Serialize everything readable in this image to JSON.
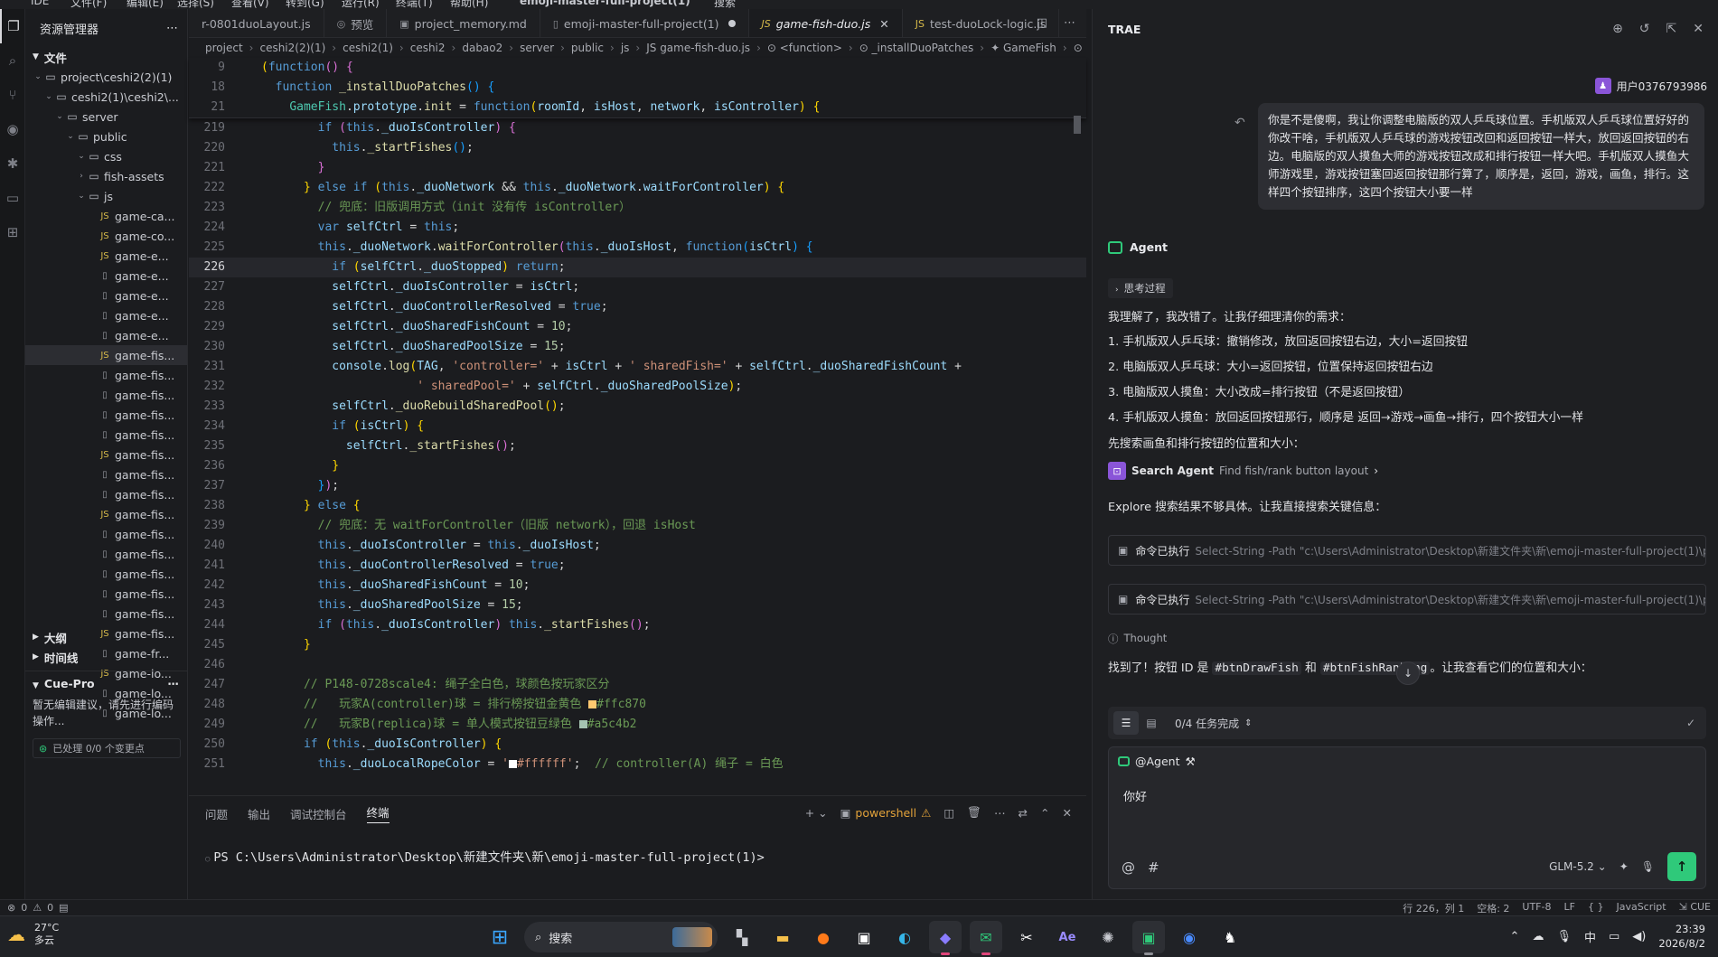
{
  "titlebar": {
    "ide": "IDE",
    "file": "文件(F)",
    "edit": "编辑(E)",
    "select": "选择(S)",
    "view": "查看(V)",
    "goto": "转到(G)",
    "run": "运行(R)",
    "terminal": "终端(T)",
    "help": "帮助(H)",
    "project": "emoji-master-full-project(1)",
    "search": "搜索"
  },
  "sidebar": {
    "title": "资源管理器",
    "section_files": "文件",
    "tree": [
      {
        "label": "project\\ceshi2(2)(1)",
        "type": "folder",
        "indent": 0,
        "open": true
      },
      {
        "label": "ceshi2(1)\\ceshi2\\...",
        "type": "folder",
        "indent": 1,
        "open": true
      },
      {
        "label": "server",
        "type": "folder",
        "indent": 2,
        "open": true
      },
      {
        "label": "public",
        "type": "folder",
        "indent": 3,
        "open": true
      },
      {
        "label": "css",
        "type": "folder",
        "indent": 4,
        "open": true
      },
      {
        "label": "fish-assets",
        "type": "folder",
        "indent": 4,
        "open": false
      },
      {
        "label": "js",
        "type": "folder",
        "indent": 4,
        "open": true
      },
      {
        "label": "game-ca...",
        "type": "js",
        "indent": 5
      },
      {
        "label": "game-co...",
        "type": "js",
        "indent": 5
      },
      {
        "label": "game-e...",
        "type": "js",
        "indent": 5
      },
      {
        "label": "game-e...",
        "type": "file",
        "indent": 5
      },
      {
        "label": "game-e...",
        "type": "file",
        "indent": 5
      },
      {
        "label": "game-e...",
        "type": "file",
        "indent": 5
      },
      {
        "label": "game-e...",
        "type": "file",
        "indent": 5
      },
      {
        "label": "game-fis...",
        "type": "js",
        "indent": 5,
        "selected": true
      },
      {
        "label": "game-fis...",
        "type": "file",
        "indent": 5
      },
      {
        "label": "game-fis...",
        "type": "file",
        "indent": 5
      },
      {
        "label": "game-fis...",
        "type": "file",
        "indent": 5
      },
      {
        "label": "game-fis...",
        "type": "file",
        "indent": 5
      },
      {
        "label": "game-fis...",
        "type": "js",
        "indent": 5
      },
      {
        "label": "game-fis...",
        "type": "file",
        "indent": 5
      },
      {
        "label": "game-fis...",
        "type": "file",
        "indent": 5
      },
      {
        "label": "game-fis...",
        "type": "js",
        "indent": 5
      },
      {
        "label": "game-fis...",
        "type": "file",
        "indent": 5
      },
      {
        "label": "game-fis...",
        "type": "file",
        "indent": 5
      },
      {
        "label": "game-fis...",
        "type": "file",
        "indent": 5
      },
      {
        "label": "game-fis...",
        "type": "file",
        "indent": 5
      },
      {
        "label": "game-fis...",
        "type": "file",
        "indent": 5
      },
      {
        "label": "game-fis...",
        "type": "js",
        "indent": 5
      },
      {
        "label": "game-fr...",
        "type": "file",
        "indent": 5
      },
      {
        "label": "game-lo...",
        "type": "js",
        "indent": 5
      },
      {
        "label": "game-lo...",
        "type": "file",
        "indent": 5
      },
      {
        "label": "game-lo...",
        "type": "file",
        "indent": 5
      }
    ],
    "outline": "大纲",
    "timeline": "时间线",
    "cue_title": "Cue-Pro",
    "cue_text": "暂无编辑建议，请先进行编码操作...",
    "cue_status": "已处理 0/0 个变更点"
  },
  "tabs": [
    {
      "label": "r-0801duoLayout.js",
      "icon": "",
      "active": false
    },
    {
      "label": "预览",
      "icon": "◎",
      "active": false
    },
    {
      "label": "project_memory.md",
      "icon": "▣",
      "active": false
    },
    {
      "label": "emoji-master-full-project(1)",
      "icon": "▯",
      "active": false,
      "dirty": true
    },
    {
      "label": "game-fish-duo.js",
      "icon": "JS",
      "active": true
    },
    {
      "label": "test-duoLock-logic.js",
      "icon": "JS",
      "active": false
    }
  ],
  "breadcrumb": [
    "project",
    "ceshi2(2)(1)",
    "ceshi2(1)",
    "ceshi2",
    "dabao2",
    "server",
    "public",
    "js",
    "JS game-fish-duo.js",
    "⊙ <function>",
    "⊙ _installDuoPatches",
    "✦ GameFish",
    "⊙ init",
    "⊙"
  ],
  "code": [
    {
      "ln": "9",
      "sticky": true,
      "html": "<span class='br1'>(</span><span class='kw'>function</span><span class='br2'>()</span> <span class='br2'>{</span>"
    },
    {
      "ln": "18",
      "sticky": true,
      "html": "  <span class='kw'>function</span> <span class='fn'>_installDuoPatches</span><span class='br3'>()</span> <span class='br3'>{</span>"
    },
    {
      "ln": "21",
      "sticky": true,
      "html": "    <span class='cls'>GameFish</span>.<span class='pr'>prototype</span>.<span class='fn'>init</span> = <span class='kw'>function</span><span class='br1'>(</span><span class='pm'>roomId</span>, <span class='pm'>isHost</span>, <span class='pm'>network</span>, <span class='pm'>isController</span><span class='br1'>)</span> <span class='br1'>{</span>"
    },
    {
      "ln": "219",
      "html": "        <span class='kw'>if</span> <span class='br2'>(</span><span class='th'>this</span>.<span class='pr'>_duoIsController</span><span class='br2'>)</span> <span class='br2'>{</span>"
    },
    {
      "ln": "220",
      "html": "          <span class='th'>this</span>.<span class='fn'>_startFishes</span><span class='br3'>()</span>;"
    },
    {
      "ln": "221",
      "html": "        <span class='br2'>}</span>"
    },
    {
      "ln": "222",
      "html": "      <span class='br1'>}</span> <span class='kw'>else if</span> <span class='br1'>(</span><span class='th'>this</span>.<span class='pr'>_duoNetwork</span> &amp;&amp; <span class='th'>this</span>.<span class='pr'>_duoNetwork</span>.<span class='pr'>waitForController</span><span class='br1'>)</span> <span class='br1'>{</span>"
    },
    {
      "ln": "223",
      "html": "        <span class='cm'>// 兜底：旧版调用方式（init 没有传 isController）</span>"
    },
    {
      "ln": "224",
      "html": "        <span class='kw'>var</span> <span class='pm'>selfCtrl</span> = <span class='th'>this</span>;"
    },
    {
      "ln": "225",
      "html": "        <span class='th'>this</span>.<span class='pr'>_duoNetwork</span>.<span class='fn'>waitForController</span><span class='br2'>(</span><span class='th'>this</span>.<span class='pr'>_duoIsHost</span>, <span class='kw'>function</span><span class='br3'>(</span><span class='pm'>isCtrl</span><span class='br3'>)</span> <span class='br3'>{</span>"
    },
    {
      "ln": "226",
      "cur": true,
      "html": "          <span class='kw'>if</span> <span class='br1'>(</span><span class='pm'>selfCtrl</span>.<span class='pr'>_duoStopped</span><span class='br1'>)</span> <span class='kw'>return</span>;"
    },
    {
      "ln": "227",
      "html": "          <span class='pm'>selfCtrl</span>.<span class='pr'>_duoIsController</span> = <span class='pm'>isCtrl</span>;"
    },
    {
      "ln": "228",
      "html": "          <span class='pm'>selfCtrl</span>.<span class='pr'>_duoControllerResolved</span> = <span class='bo'>true</span>;"
    },
    {
      "ln": "229",
      "html": "          <span class='pm'>selfCtrl</span>.<span class='pr'>_duoSharedFishCount</span> = <span class='nm'>10</span>;"
    },
    {
      "ln": "230",
      "html": "          <span class='pm'>selfCtrl</span>.<span class='pr'>_duoSharedPoolSize</span> = <span class='nm'>15</span>;"
    },
    {
      "ln": "231",
      "html": "          <span class='pr'>console</span>.<span class='fn'>log</span><span class='br1'>(</span><span class='pr'>TAG</span>, <span class='st'>'controller='</span> + <span class='pm'>isCtrl</span> + <span class='st'>' sharedFish='</span> + <span class='pm'>selfCtrl</span>.<span class='pr'>_duoSharedFishCount</span> +"
    },
    {
      "ln": "232",
      "html": "                      <span class='st'>' sharedPool='</span> + <span class='pm'>selfCtrl</span>.<span class='pr'>_duoSharedPoolSize</span><span class='br1'>)</span>;"
    },
    {
      "ln": "233",
      "html": "          <span class='pm'>selfCtrl</span>.<span class='fn'>_duoRebuildSharedPool</span><span class='br1'>()</span>;"
    },
    {
      "ln": "234",
      "html": "          <span class='kw'>if</span> <span class='br1'>(</span><span class='pm'>isCtrl</span><span class='br1'>)</span> <span class='br1'>{</span>"
    },
    {
      "ln": "235",
      "html": "            <span class='pm'>selfCtrl</span>.<span class='fn'>_startFishes</span><span class='br2'>()</span>;"
    },
    {
      "ln": "236",
      "html": "          <span class='br1'>}</span>"
    },
    {
      "ln": "237",
      "html": "        <span class='br3'>}</span><span class='br2'>)</span>;"
    },
    {
      "ln": "238",
      "html": "      <span class='br1'>}</span> <span class='kw'>else</span> <span class='br1'>{</span>"
    },
    {
      "ln": "239",
      "html": "        <span class='cm'>// 兜底：无 waitForController（旧版 network），回退 isHost</span>"
    },
    {
      "ln": "240",
      "html": "        <span class='th'>this</span>.<span class='pr'>_duoIsController</span> = <span class='th'>this</span>.<span class='pr'>_duoIsHost</span>;"
    },
    {
      "ln": "241",
      "html": "        <span class='th'>this</span>.<span class='pr'>_duoControllerResolved</span> = <span class='bo'>true</span>;"
    },
    {
      "ln": "242",
      "html": "        <span class='th'>this</span>.<span class='pr'>_duoSharedFishCount</span> = <span class='nm'>10</span>;"
    },
    {
      "ln": "243",
      "html": "        <span class='th'>this</span>.<span class='pr'>_duoSharedPoolSize</span> = <span class='nm'>15</span>;"
    },
    {
      "ln": "244",
      "html": "        <span class='kw'>if</span> <span class='br2'>(</span><span class='th'>this</span>.<span class='pr'>_duoIsController</span><span class='br2'>)</span> <span class='th'>this</span>.<span class='fn'>_startFishes</span><span class='br2'>()</span>;"
    },
    {
      "ln": "245",
      "html": "      <span class='br1'>}</span>"
    },
    {
      "ln": "246",
      "html": ""
    },
    {
      "ln": "247",
      "html": "      <span class='cm'>// P148-0728scale4: 绳子全白色，球颜色按玩家区分</span>"
    },
    {
      "ln": "248",
      "html": "      <span class='cm'>//   玩家A(controller)球 = 排行榜按钮金黄色 </span><span style='display:inline-block;width:9px;height:9px;background:#ffc870;vertical-align:middle'></span><span class='cm'>#ffc870</span>"
    },
    {
      "ln": "249",
      "html": "      <span class='cm'>//   玩家B(replica)球 = 单人模式按钮豆绿色 </span><span style='display:inline-block;width:9px;height:9px;background:#a5c4b2;vertical-align:middle'></span><span class='cm'>#a5c4b2</span>"
    },
    {
      "ln": "250",
      "html": "      <span class='kw'>if</span> <span class='br1'>(</span><span class='th'>this</span>.<span class='pr'>_duoIsController</span><span class='br1'>)</span> <span class='br1'>{</span>"
    },
    {
      "ln": "251",
      "html": "        <span class='th'>this</span>.<span class='pr'>_duoLocalRopeColor</span> = <span class='st'>'</span><span style='display:inline-block;width:9px;height:9px;background:#ffffff;vertical-align:middle'></span><span class='st'>#ffffff'</span>;  <span class='cm'>// controller(A) 绳子 = 白色</span>"
    }
  ],
  "panel": {
    "tabs": [
      "问题",
      "输出",
      "调试控制台",
      "终端"
    ],
    "active": "终端",
    "shell": "powershell",
    "prompt": "PS C:\\Users\\Administrator\\Desktop\\新建文件夹\\新\\emoji-master-full-project(1)>"
  },
  "chat": {
    "brand": "TRAE",
    "user": "用户0376793986",
    "user_message": "你是不是傻啊，我让你调整电脑版的双人乒乓球位置。手机版双人乒乓球位置好好的你改干啥，手机版双人乒乓球的游戏按钮改回和返回按钮一样大，放回返回按钮的右边。电脑版的双人摸鱼大师的游戏按钮改成和排行按钮一样大吧。手机版双人摸鱼大师游戏里，游戏按钮塞回返回按钮那行算了，顺序是，返回，游戏，画鱼，排行。这样四个按钮排序，这四个按钮大小要一样",
    "agent": "Agent",
    "thinking": "思考过程",
    "lines": [
      "我理解了，我改错了。让我仔细理清你的需求：",
      "1. 手机版双人乒乓球：撤销修改，放回返回按钮右边，大小=返回按钮",
      "2. 电脑版双人乒乓球：大小=返回按钮，位置保持返回按钮右边",
      "3. 电脑版双人摸鱼：大小改成=排行按钮（不是返回按钮）",
      "4. 手机版双人摸鱼：放回返回按钮那行，顺序是 返回→游戏→画鱼→排行，四个按钮大小一样",
      "先搜索画鱼和排行按钮的位置和大小："
    ],
    "search_agent": "Search Agent",
    "search_detail": "Find fish/rank button layout",
    "explore": "Explore 搜索结果不够具体。让我直接搜索关键信息：",
    "cmd_label": "命令已执行",
    "cmd_1": "Select-String -Path \"c:\\Users\\Administrator\\Desktop\\新建文件夹\\新\\emoji-master-full-project(1)\\project...",
    "cmd_2": "Select-String -Path \"c:\\Users\\Administrator\\Desktop\\新建文件夹\\新\\emoji-master-full-project(1)\\project...",
    "thought": "Thought",
    "found_pre": "找到了！按钮 ID 是 ",
    "found_id1": "#btnDrawFish",
    "found_mid": " 和 ",
    "found_id2": "#btnFishRanking",
    "found_post": "。让我查看它们的位置和大小：",
    "tasks": "0/4 任务完成",
    "mention": "@Agent",
    "input_text": "你好",
    "model": "GLM-5.2"
  },
  "statusbar": {
    "errors": "0",
    "warnings": "0",
    "position": "行 226，列 1",
    "spaces": "空格: 2",
    "encoding": "UTF-8",
    "eol": "LF",
    "braces": "{ }",
    "language": "JavaScript",
    "cue": "CUE"
  },
  "taskbar": {
    "temp": "27°C",
    "weather": "多云",
    "search": "搜索",
    "ime": "中",
    "time": "23:39",
    "date": "2026/8/2"
  }
}
